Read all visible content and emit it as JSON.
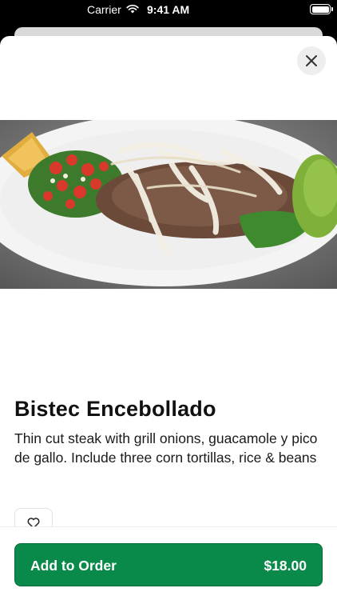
{
  "status_bar": {
    "carrier": "Carrier",
    "time": "9:41 AM"
  },
  "item": {
    "title": "Bistec Encebollado",
    "description": "Thin cut steak with grill onions, guacamole y pico de gallo. Include three corn tortillas, rice & beans",
    "image_icon": "dish-photo"
  },
  "actions": {
    "close_icon": "close-icon",
    "favorite_icon": "heart-icon",
    "add_label": "Add to Order",
    "price": "$18.00"
  },
  "colors": {
    "accent": "#0a8a4a",
    "text": "#111111"
  }
}
